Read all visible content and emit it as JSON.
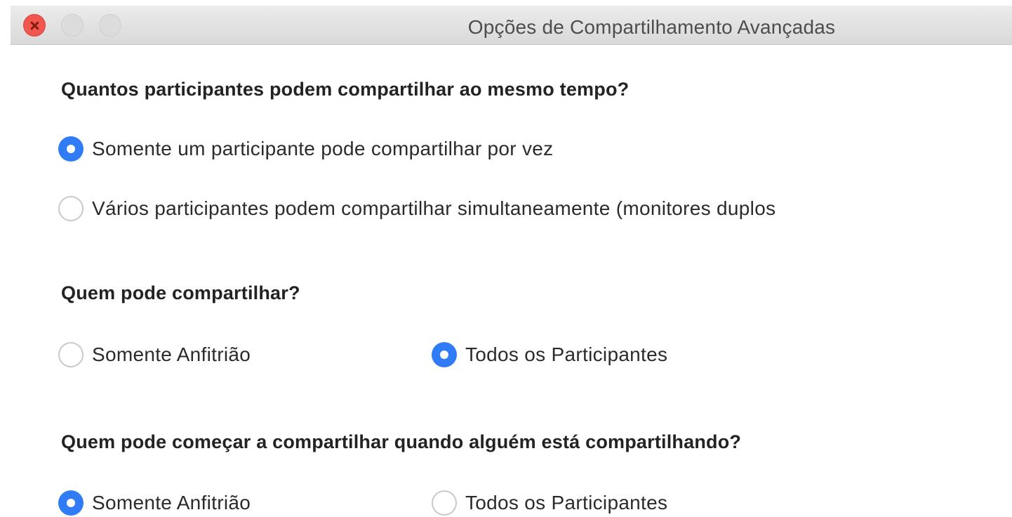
{
  "window": {
    "title": "Opções de Compartilhamento Avançadas"
  },
  "sections": [
    {
      "question": "Quantos participantes podem compartilhar ao mesmo tempo?",
      "options": [
        {
          "label": "Somente um participante pode compartilhar por vez",
          "checked": true
        },
        {
          "label": "Vários participantes podem compartilhar simultaneamente (monitores duplos",
          "checked": false
        }
      ]
    },
    {
      "question": "Quem pode compartilhar?",
      "options": [
        {
          "label": "Somente Anfitrião",
          "checked": false
        },
        {
          "label": "Todos os Participantes",
          "checked": true
        }
      ]
    },
    {
      "question": "Quem pode começar a compartilhar quando alguém está compartilhando?",
      "options": [
        {
          "label": "Somente Anfitrião",
          "checked": true
        },
        {
          "label": "Todos os Participantes",
          "checked": false
        }
      ]
    }
  ],
  "colors": {
    "accent": "#2f7cf6",
    "close_button": "#f0584f"
  }
}
